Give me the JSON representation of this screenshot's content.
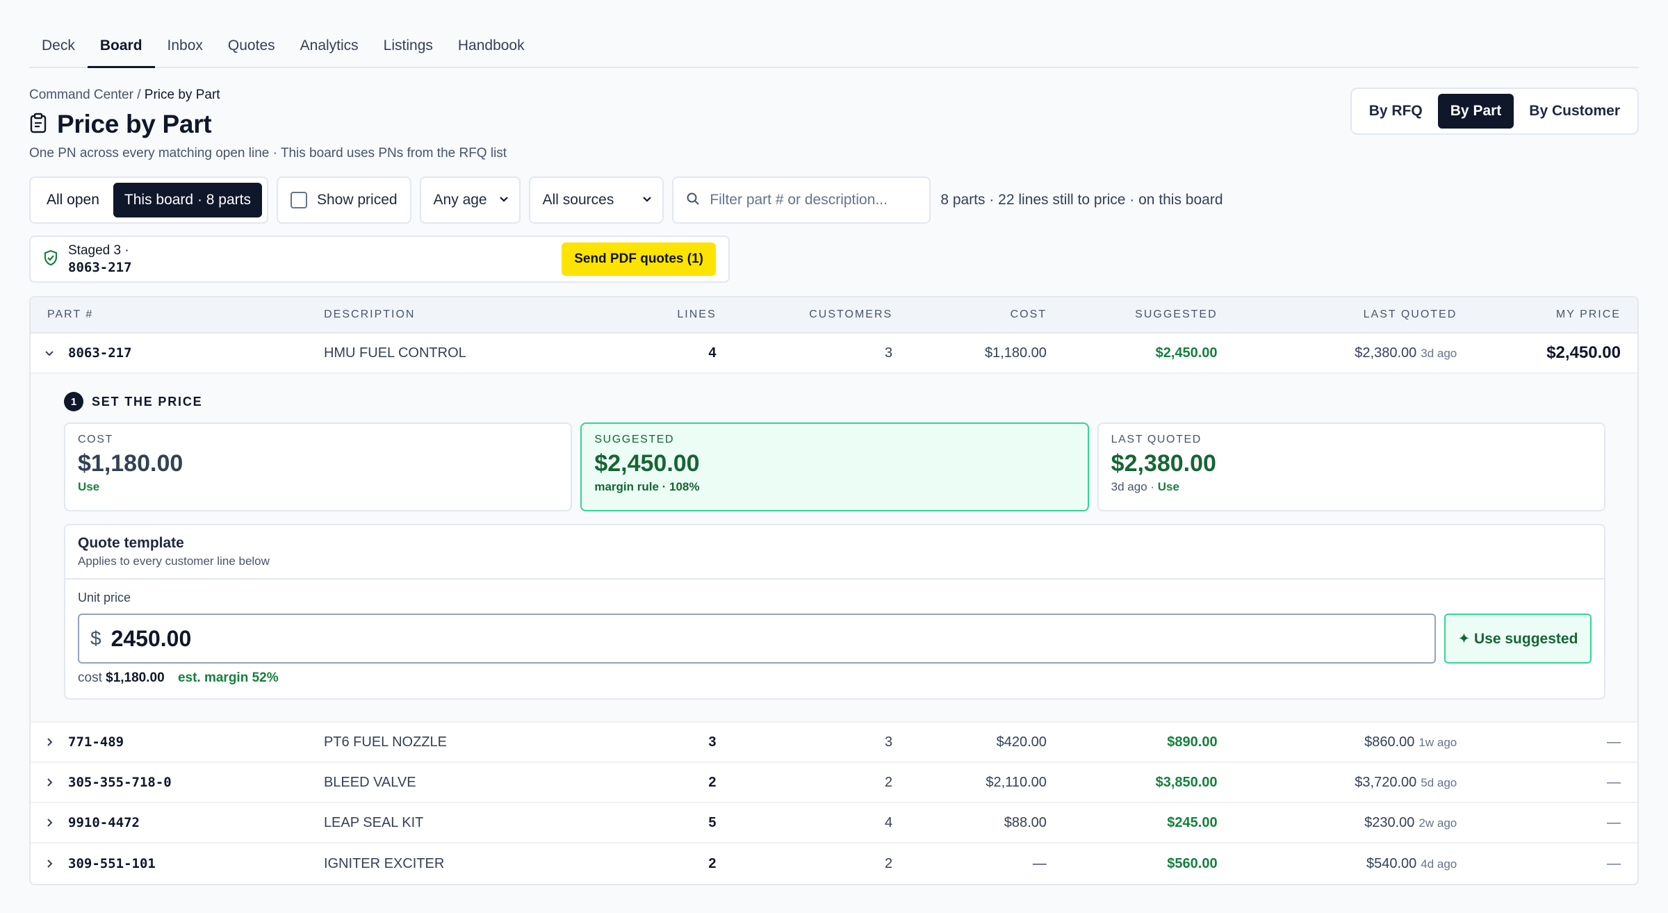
{
  "nav": {
    "tabs": [
      "Deck",
      "Board",
      "Inbox",
      "Quotes",
      "Analytics",
      "Listings",
      "Handbook"
    ],
    "active": "Board"
  },
  "breadcrumb": {
    "parent": "Command Center",
    "sep": "/",
    "current": "Price by Part"
  },
  "page": {
    "title": "Price by Part",
    "subtitle": "One PN across every matching open line · This board uses PNs from the RFQ list"
  },
  "view_toggle": {
    "by_rfq": "By RFQ",
    "by_part": "By Part",
    "by_customer": "By Customer",
    "active": "By Part"
  },
  "filters": {
    "all_open": "All open",
    "this_board": "This board · 8 parts",
    "show_priced": "Show priced",
    "age": "Any age",
    "sources": "All sources",
    "search_placeholder": "Filter part # or description...",
    "summary": "8 parts · 22 lines still to price · on this board"
  },
  "staged": {
    "label": "Staged 3 ·",
    "part": "8063-217",
    "send_label": "Send PDF quotes (1)"
  },
  "table": {
    "headers": {
      "part": "PART #",
      "description": "DESCRIPTION",
      "lines": "LINES",
      "customers": "CUSTOMERS",
      "cost": "COST",
      "suggested": "SUGGESTED",
      "last_quoted": "LAST QUOTED",
      "my_price": "MY PRICE"
    },
    "expanded_row": {
      "part": "8063-217",
      "description": "HMU FUEL CONTROL",
      "lines": "4",
      "customers": "3",
      "cost": "$1,180.00",
      "suggested": "$2,450.00",
      "last_quoted": "$2,380.00",
      "last_ago": "3d ago",
      "my_price": "$2,450.00"
    },
    "rows": [
      {
        "part": "771-489",
        "description": "PT6 FUEL NOZZLE",
        "lines": "3",
        "customers": "3",
        "cost": "$420.00",
        "suggested": "$890.00",
        "last_quoted": "$860.00",
        "last_ago": "1w ago",
        "my_price": "—"
      },
      {
        "part": "305-355-718-0",
        "description": "BLEED VALVE",
        "lines": "2",
        "customers": "2",
        "cost": "$2,110.00",
        "suggested": "$3,850.00",
        "last_quoted": "$3,720.00",
        "last_ago": "5d ago",
        "my_price": "—"
      },
      {
        "part": "9910-4472",
        "description": "LEAP SEAL KIT",
        "lines": "5",
        "customers": "4",
        "cost": "$88.00",
        "suggested": "$245.00",
        "last_quoted": "$230.00",
        "last_ago": "2w ago",
        "my_price": "—"
      },
      {
        "part": "309-551-101",
        "description": "IGNITER EXCITER",
        "lines": "2",
        "customers": "2",
        "cost": "—",
        "suggested": "$560.00",
        "last_quoted": "$540.00",
        "last_ago": "4d ago",
        "my_price": "—"
      }
    ]
  },
  "set_price": {
    "step": "1",
    "title": "SET THE PRICE",
    "cost_card": {
      "label": "COST",
      "value": "$1,180.00",
      "use": "Use"
    },
    "suggested_card": {
      "label": "SUGGESTED",
      "value": "$2,450.00",
      "note": "margin rule · 108%"
    },
    "last_card": {
      "label": "LAST QUOTED",
      "value": "$2,380.00",
      "ago": "3d ago ·",
      "use": "Use"
    },
    "template": {
      "title": "Quote template",
      "subtitle": "Applies to every customer line below",
      "unit_label": "Unit price",
      "currency": "$",
      "unit_value": "2450.00",
      "use_suggested": "✦ Use suggested",
      "cost_prefix": "cost",
      "cost_value": "$1,180.00",
      "margin": "est. margin 52%"
    }
  },
  "colors": {
    "primary": "#0f172a",
    "accent_yellow": "#fde400",
    "green": "#15803d",
    "green_bg": "#ecfdf5"
  }
}
